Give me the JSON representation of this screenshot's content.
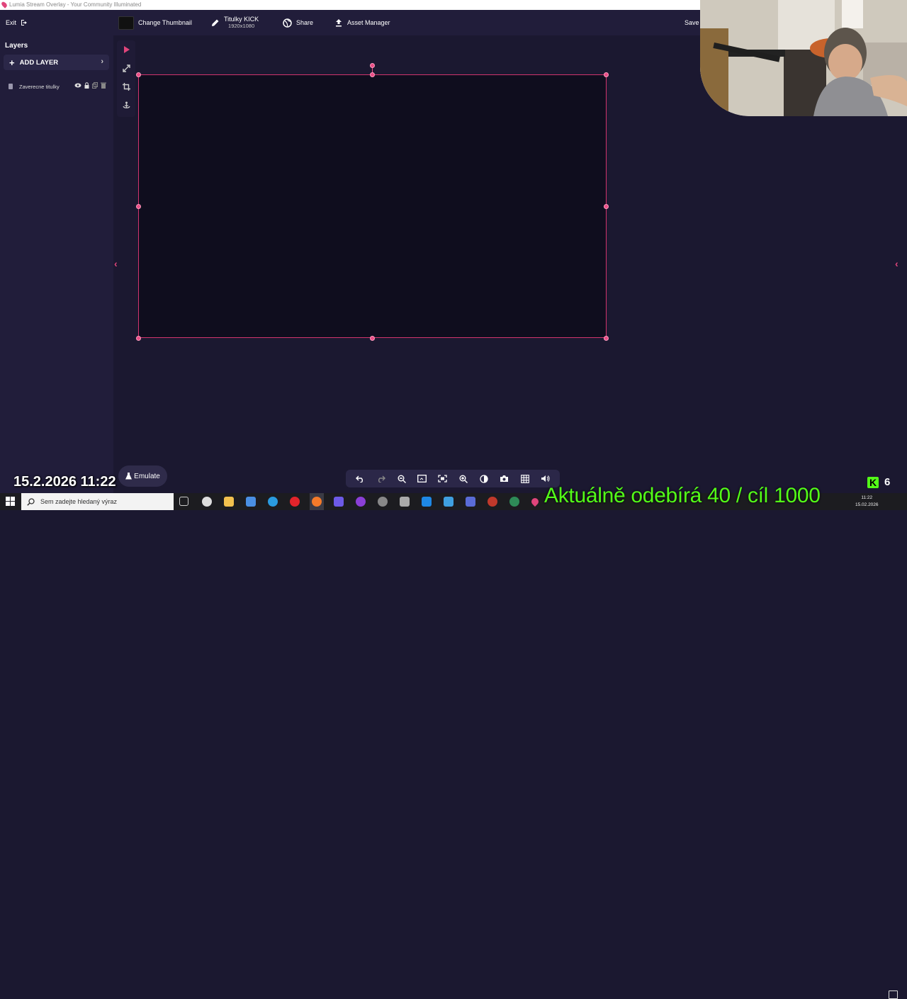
{
  "window": {
    "title": "Lumia Stream Overlay - Your Community Illuminated"
  },
  "toolbar": {
    "exit_label": "Exit",
    "change_thumbnail_label": "Change Thumbnail",
    "overlay_name": "Titulky KICK",
    "overlay_resolution": "1920x1080",
    "share_label": "Share",
    "asset_manager_label": "Asset Manager",
    "save_label": "Save"
  },
  "layers_panel": {
    "heading": "Layers",
    "add_layer_label": "ADD LAYER",
    "items": [
      {
        "name": "Zaverecne titulky"
      }
    ]
  },
  "tools": [
    "pointer-icon",
    "resize-icon",
    "crop-icon",
    "anchor-icon"
  ],
  "bottom": {
    "emulate_label": "Emulate",
    "zoombar_icons": [
      "undo-icon",
      "redo-icon",
      "zoom-out-icon",
      "fit-screen-icon",
      "fullscreen-icon",
      "zoom-in-icon",
      "contrast-icon",
      "camera-icon",
      "grid-icon",
      "volume-icon"
    ]
  },
  "stream_overlay": {
    "datetime": "15.2.2026 11:22",
    "kick_count": "6",
    "ticker_text": "Aktuálně odebírá 40 / cíl 1000"
  },
  "taskbar": {
    "search_placeholder": "Sem zadejte hledaný výraz",
    "clock_time": "11:22",
    "clock_date": "15.02.2026"
  },
  "colors": {
    "accent": "#e0457b",
    "panel": "#211d3a",
    "background": "#1b1830",
    "kick_green": "#53fc18"
  }
}
